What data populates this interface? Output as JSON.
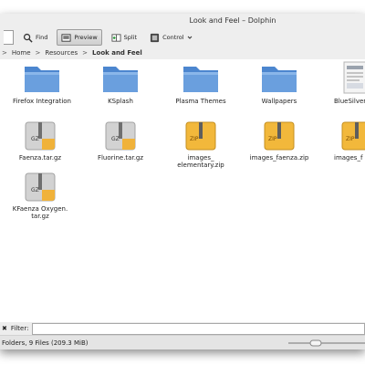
{
  "window": {
    "title": "Look and Feel – Dolphin"
  },
  "toolbar": {
    "find_label": "Find",
    "preview_label": "Preview",
    "split_label": "Split",
    "control_label": "Control"
  },
  "breadcrumb": {
    "items": [
      "Home",
      "Resources",
      "Look and Feel"
    ],
    "separator": ">"
  },
  "files": [
    {
      "name": "Firefox Integration",
      "type": "folder"
    },
    {
      "name": "KSplash",
      "type": "folder"
    },
    {
      "name": "Plasma Themes",
      "type": "folder"
    },
    {
      "name": "Wallpapers",
      "type": "folder"
    },
    {
      "name": "BlueSilver",
      "type": "image"
    },
    {
      "name": "Faenza.tar.gz",
      "type": "gz",
      "badge": "GZ"
    },
    {
      "name": "Fluorine.tar.gz",
      "type": "gz",
      "badge": "GZ"
    },
    {
      "name": "images_\nelementary.zip",
      "type": "zip",
      "badge": "ZIP"
    },
    {
      "name": "images_faenza.zip",
      "type": "zip",
      "badge": "ZIP"
    },
    {
      "name": "images_f",
      "type": "zip",
      "badge": "ZIP"
    },
    {
      "name": "KFaenza Oxygen.\ntar.gz",
      "type": "gz",
      "badge": "GZ"
    }
  ],
  "filter": {
    "label": "Filter:",
    "value": ""
  },
  "status": {
    "text": "Folders, 9 Files (209.3 MiB)"
  },
  "colors": {
    "folder": "#6a9fde",
    "archive_gz": "#c9c9c9",
    "archive_zip": "#f2b83b",
    "window_bg": "#f3f3f3"
  }
}
